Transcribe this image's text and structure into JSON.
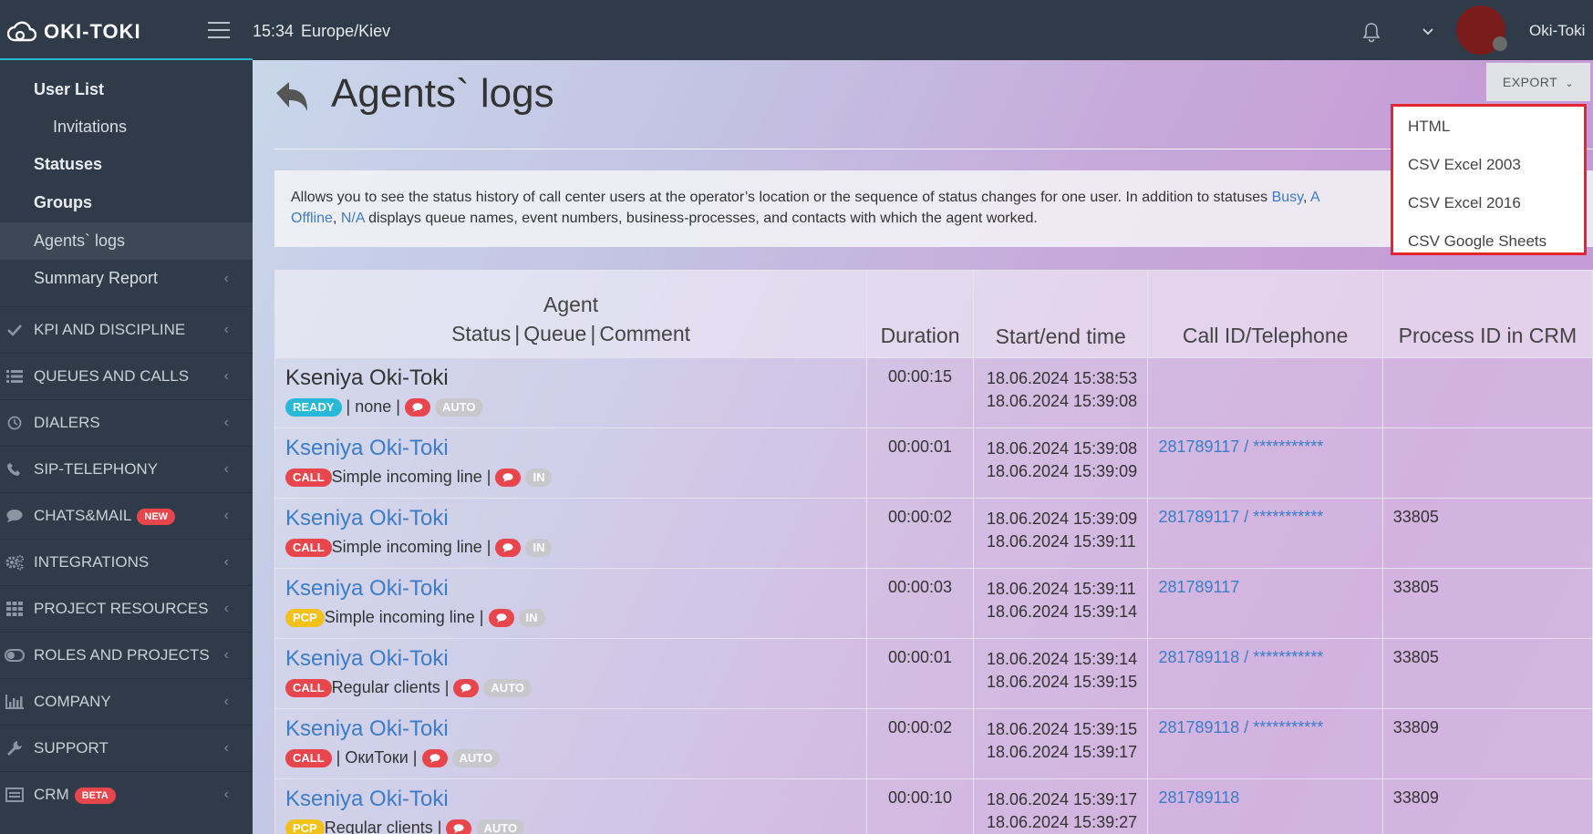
{
  "topbar": {
    "logo": "OKI-TOKI",
    "time": "15:34",
    "timezone": "Europe/Kiev",
    "username": "Oki-Toki"
  },
  "sidebar": {
    "sub_items": [
      {
        "label": "User List"
      },
      {
        "label": "Invitations"
      },
      {
        "label": "Statuses"
      },
      {
        "label": "Groups"
      },
      {
        "label": "Agents` logs"
      },
      {
        "label": "Summary Report"
      }
    ],
    "nav_items": [
      {
        "label": "KPI AND DISCIPLINE",
        "icon": "check-icon"
      },
      {
        "label": "QUEUES AND CALLS",
        "icon": "list-icon"
      },
      {
        "label": "DIALERS",
        "icon": "clock-icon"
      },
      {
        "label": "SIP-TELEPHONY",
        "icon": "phone-icon"
      },
      {
        "label": "CHATS&MAIL",
        "icon": "chat-icon",
        "badge": "NEW"
      },
      {
        "label": "INTEGRATIONS",
        "icon": "gears-icon"
      },
      {
        "label": "PROJECT RESOURCES",
        "icon": "grid-icon"
      },
      {
        "label": "ROLES AND PROJECTS",
        "icon": "toggle-icon"
      },
      {
        "label": "COMPANY",
        "icon": "bar-chart-icon"
      },
      {
        "label": "SUPPORT",
        "icon": "wrench-icon"
      },
      {
        "label": "CRM",
        "icon": "crm-icon",
        "badge": "BETA"
      }
    ]
  },
  "page": {
    "title": "Agents` logs",
    "info_text_1": "Allows you to see the status history of call center users at the operator’s location or the sequence of status changes for one user. In addition to statuses ",
    "info_link_busy": "Busy",
    "info_text_2": ", ",
    "info_link_a": "A",
    "info_link_offline": "Offline",
    "info_text_3": ", ",
    "info_link_na": "N/A",
    "info_text_4": " displays queue names, event numbers, business-processes, and contacts with which the agent worked."
  },
  "export": {
    "label": "EXPORT",
    "options": [
      "HTML",
      "CSV Excel 2003",
      "CSV Excel 2016",
      "CSV Google Sheets"
    ]
  },
  "table": {
    "headers": {
      "agent": "Agent",
      "status": "Status",
      "queue": "Queue",
      "comment": "Comment",
      "duration": "Duration",
      "time": "Start/end time",
      "call": "Call ID/Telephone",
      "process": "Process ID in CRM"
    },
    "rows": [
      {
        "agent": "Kseniya Oki-Toki",
        "status": "READY",
        "queue": " | none | ",
        "type": "AUTO",
        "duration": "00:00:15",
        "start": "18.06.2024 15:38:53",
        "end": "18.06.2024 15:39:08",
        "call": "",
        "process": ""
      },
      {
        "agent": "Kseniya Oki-Toki",
        "status": "CALL",
        "queue": "Simple incoming line | ",
        "type": "IN",
        "duration": "00:00:01",
        "start": "18.06.2024 15:39:08",
        "end": "18.06.2024 15:39:09",
        "call": "281789117 / ***********",
        "process": ""
      },
      {
        "agent": "Kseniya Oki-Toki",
        "status": "CALL",
        "queue": "Simple incoming line | ",
        "type": "IN",
        "duration": "00:00:02",
        "start": "18.06.2024 15:39:09",
        "end": "18.06.2024 15:39:11",
        "call": "281789117 / ***********",
        "process": "33805"
      },
      {
        "agent": "Kseniya Oki-Toki",
        "status": "PCP",
        "queue": "Simple incoming line | ",
        "type": "IN",
        "duration": "00:00:03",
        "start": "18.06.2024 15:39:11",
        "end": "18.06.2024 15:39:14",
        "call": "281789117",
        "process": "33805"
      },
      {
        "agent": "Kseniya Oki-Toki",
        "status": "CALL",
        "queue": "Regular clients | ",
        "type": "AUTO",
        "duration": "00:00:01",
        "start": "18.06.2024 15:39:14",
        "end": "18.06.2024 15:39:15",
        "call": "281789118 / ***********",
        "process": "33805"
      },
      {
        "agent": "Kseniya Oki-Toki",
        "status": "CALL",
        "queue": " | ОкиТоки | ",
        "type": "AUTO",
        "duration": "00:00:02",
        "start": "18.06.2024 15:39:15",
        "end": "18.06.2024 15:39:17",
        "call": "281789118 / ***********",
        "process": "33809"
      },
      {
        "agent": "Kseniya Oki-Toki",
        "status": "PCP",
        "queue": "Regular clients | ",
        "type": "AUTO",
        "duration": "00:00:10",
        "start": "18.06.2024 15:39:17",
        "end": "18.06.2024 15:39:27",
        "call": "281789118",
        "process": "33809"
      }
    ]
  },
  "colors": {
    "topbar_bg": "#2f3b48",
    "accent": "#27b8cf",
    "link": "#3c7cc8",
    "ready": "#28b8d8",
    "call": "#e9454d",
    "pcp": "#f2c21b",
    "dropdown_border": "#e3262f"
  }
}
